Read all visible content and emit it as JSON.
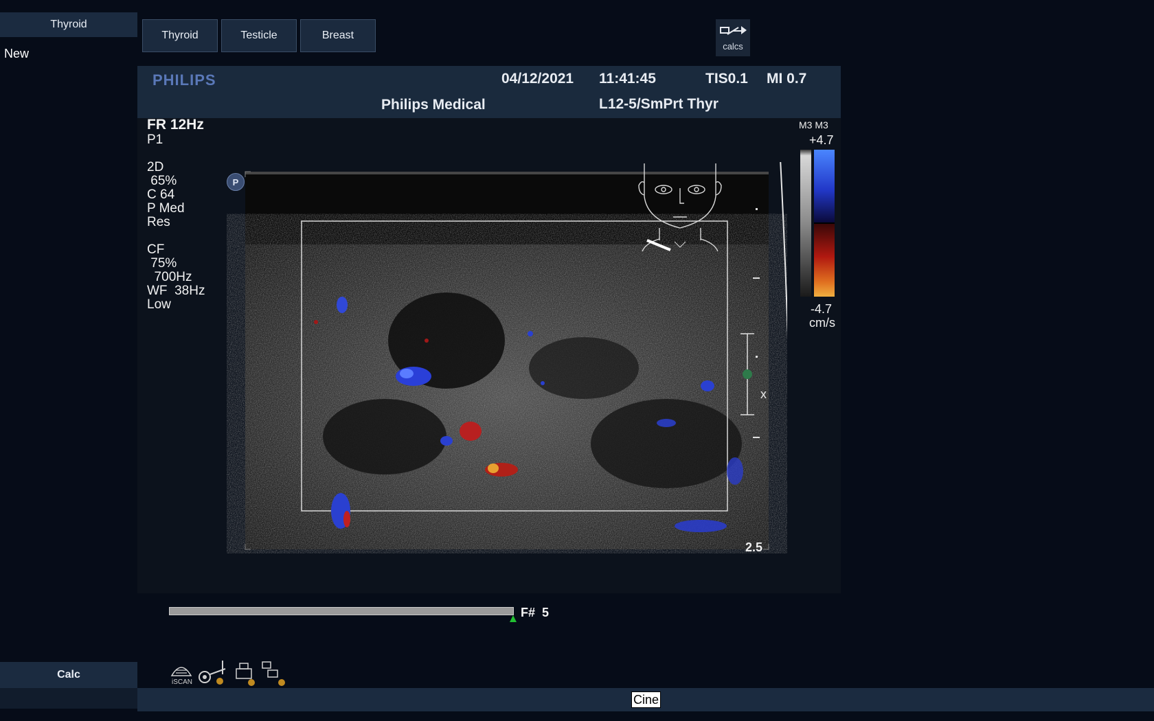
{
  "left_panel": {
    "header": "Thyroid",
    "item": "New",
    "calc_button": "Calc"
  },
  "tabs": [
    "Thyroid",
    "Testicle",
    "Breast"
  ],
  "calcs_button": {
    "label": "calcs",
    "icon": "calcs-arrow-icon"
  },
  "header": {
    "brand": "PHILIPS",
    "date": "04/12/2021",
    "time": "11:41:45",
    "tis": "TIS0.1",
    "mi": "MI 0.7",
    "institution": "Philips Medical",
    "transducer": "L12-5/SmPrt Thyr"
  },
  "params": {
    "fr": "FR 12Hz",
    "p": "P1",
    "mode_2d": "2D",
    "gain_2d": " 65%",
    "c": "C 64",
    "pmed": "P Med",
    "res": "Res",
    "mode_cf": "CF",
    "gain_cf": " 75%",
    "freq": "  700Hz",
    "wf": "WF  38Hz",
    "low": "Low"
  },
  "colorbar": {
    "map": "M3 M3",
    "max": "+4.7",
    "min": "-4.7",
    "unit": "cm/s",
    "colors": {
      "top": "#3a66e0",
      "bottom": "#e0a030"
    }
  },
  "depth_label": "2.5",
  "marker_label": "x",
  "p_marker": "P",
  "frame": {
    "label": "F#  5",
    "value": 5
  },
  "status": {
    "cine": "Cine"
  },
  "bottom_icons": [
    "iscan-icon",
    "probe-icon",
    "print-icon",
    "network-icon"
  ],
  "iscan_label": "iSCAN"
}
